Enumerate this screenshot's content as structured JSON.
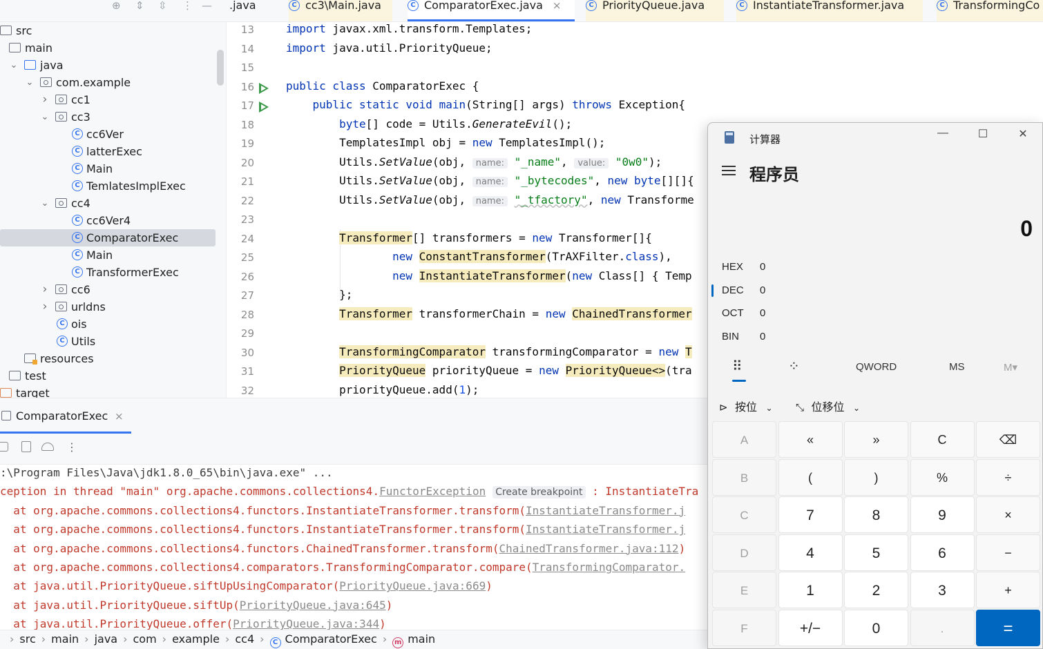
{
  "project_tree": {
    "items": [
      {
        "label": "src",
        "indent": 0,
        "icon": "folder-icon",
        "chevron": ""
      },
      {
        "label": "main",
        "indent": 1,
        "icon": "folder-icon",
        "chevron": ""
      },
      {
        "label": "java",
        "indent": 2,
        "icon": "source-folder-icon",
        "chevron": "expanded"
      },
      {
        "label": "com.example",
        "indent": 3,
        "icon": "package-icon",
        "chevron": "expanded"
      },
      {
        "label": "cc1",
        "indent": 4,
        "icon": "package-icon",
        "chevron": "collapsed"
      },
      {
        "label": "cc3",
        "indent": 4,
        "icon": "package-icon",
        "chevron": "expanded"
      },
      {
        "label": "cc6Ver",
        "indent": 5,
        "icon": "class-icon",
        "chevron": ""
      },
      {
        "label": "latterExec",
        "indent": 5,
        "icon": "class-icon",
        "chevron": ""
      },
      {
        "label": "Main",
        "indent": 5,
        "icon": "class-icon",
        "chevron": ""
      },
      {
        "label": "TemlatesImplExec",
        "indent": 5,
        "icon": "class-icon",
        "chevron": ""
      },
      {
        "label": "cc4",
        "indent": 4,
        "icon": "package-icon",
        "chevron": "expanded"
      },
      {
        "label": "cc6Ver4",
        "indent": 5,
        "icon": "class-icon",
        "chevron": ""
      },
      {
        "label": "ComparatorExec",
        "indent": 5,
        "icon": "class-icon",
        "chevron": "",
        "selected": true
      },
      {
        "label": "Main",
        "indent": 5,
        "icon": "class-icon",
        "chevron": ""
      },
      {
        "label": "TransformerExec",
        "indent": 5,
        "icon": "class-icon",
        "chevron": ""
      },
      {
        "label": "cc6",
        "indent": 4,
        "icon": "package-icon",
        "chevron": "collapsed"
      },
      {
        "label": "urldns",
        "indent": 4,
        "icon": "package-icon",
        "chevron": "collapsed"
      },
      {
        "label": "ois",
        "indent": 4,
        "icon": "class-icon",
        "chevron": ""
      },
      {
        "label": "Utils",
        "indent": 4,
        "icon": "class-icon",
        "chevron": ""
      },
      {
        "label": "resources",
        "indent": 2,
        "icon": "resources-folder-icon",
        "chevron": ""
      },
      {
        "label": "test",
        "indent": 1,
        "icon": "folder-icon",
        "chevron": ""
      },
      {
        "label": "target",
        "indent": 0,
        "icon": "excluded-folder-icon",
        "chevron": ""
      }
    ]
  },
  "tabs": [
    {
      "label": ".java",
      "icon": "",
      "active": false
    },
    {
      "label": "cc3\\Main.java",
      "icon": "class-icon",
      "active": false
    },
    {
      "label": "ComparatorExec.java",
      "icon": "class-icon",
      "active": true,
      "close": "×"
    },
    {
      "label": "PriorityQueue.java",
      "icon": "class-icon",
      "active": false
    },
    {
      "label": "InstantiateTransformer.java",
      "icon": "class-icon",
      "active": false
    },
    {
      "label": "TransformingCo",
      "icon": "class-icon",
      "active": false
    }
  ],
  "editor": {
    "line_numbers": [
      "13",
      "14",
      "15",
      "16",
      "17",
      "18",
      "19",
      "20",
      "21",
      "22",
      "23",
      "24",
      "25",
      "26",
      "27",
      "28",
      "29",
      "30",
      "31",
      "32"
    ],
    "run_gutter_lines": [
      "16",
      "17"
    ],
    "hints": {
      "name": "name:",
      "value": "value:"
    }
  },
  "run_panel": {
    "tab_label": "ComparatorExec",
    "tab_close": "×",
    "console_lines": [
      ":\\Program Files\\Java\\jdk1.8.0_65\\bin\\java.exe\" ...",
      "ception in thread \"main\" org.apache.commons.collections4.",
      "FunctorException",
      "Create breakpoint",
      " : InstantiateTra",
      "  at org.apache.commons.collections4.functors.InstantiateTransformer.transform(",
      "InstantiateTransformer.j",
      "  at org.apache.commons.collections4.functors.InstantiateTransformer.transform(",
      "InstantiateTransformer.j",
      "  at org.apache.commons.collections4.functors.ChainedTransformer.transform(",
      "ChainedTransformer.java:112",
      ")",
      "  at org.apache.commons.collections4.comparators.TransformingComparator.compare(",
      "TransformingComparator.",
      "  at java.util.PriorityQueue.siftUpUsingComparator(",
      "PriorityQueue.java:669",
      ")",
      "  at java.util.PriorityQueue.siftUp(",
      "PriorityQueue.java:645",
      ")",
      "  at java.util.PriorityQueue.offer(",
      "PriorityQueue.java:344",
      ")"
    ]
  },
  "breadcrumb": [
    "src",
    "main",
    "java",
    "com",
    "example",
    "cc4",
    "ComparatorExec",
    "main"
  ],
  "calculator": {
    "title": "计算器",
    "mode": "程序员",
    "display": "0",
    "radix": [
      {
        "name": "HEX",
        "value": "0"
      },
      {
        "name": "DEC",
        "value": "0",
        "selected": true
      },
      {
        "name": "OCT",
        "value": "0"
      },
      {
        "name": "BIN",
        "value": "0"
      }
    ],
    "word_size": "QWORD",
    "memory_store": "MS",
    "memory_menu": "M▾",
    "bitwise_label": "按位",
    "bitshift_label": "位移位",
    "keys": [
      [
        "A",
        "«",
        "»",
        "C",
        "⌫"
      ],
      [
        "B",
        "(",
        ")",
        "%",
        "÷"
      ],
      [
        "C",
        "7",
        "8",
        "9",
        "×"
      ],
      [
        "D",
        "4",
        "5",
        "6",
        "−"
      ],
      [
        "E",
        "1",
        "2",
        "3",
        "+"
      ],
      [
        "F",
        "+/−",
        "0",
        ".",
        "="
      ]
    ],
    "window_buttons": {
      "minimize": "—",
      "maximize": "☐",
      "close": "✕"
    }
  },
  "colors": {
    "accent": "#3574f0",
    "calc_accent": "#0067c0",
    "keyword": "#0033b3",
    "string": "#067d17",
    "error": "#c0392b"
  }
}
